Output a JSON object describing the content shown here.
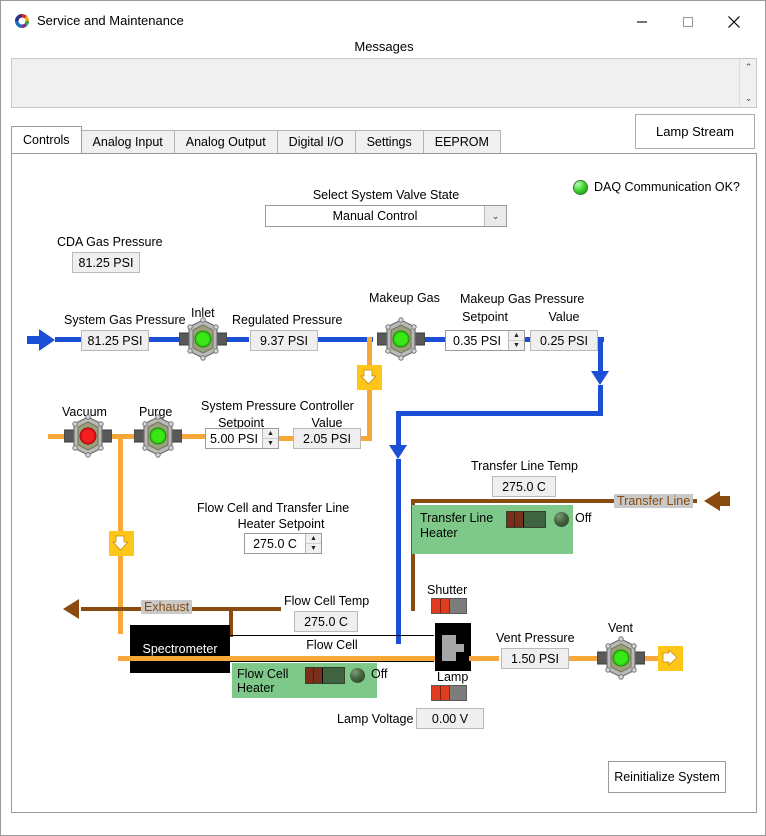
{
  "window": {
    "title": "Service and Maintenance",
    "icon": "app-icon",
    "minimize": "–",
    "maximize": "□",
    "close": "✕"
  },
  "messages": {
    "label": "Messages",
    "content": "",
    "scroll_up": "⌃",
    "scroll_down": "⌄"
  },
  "lamp_stream_button": "Lamp Stream",
  "tabs": [
    {
      "label": "Controls",
      "active": true
    },
    {
      "label": "Analog Input",
      "active": false
    },
    {
      "label": "Analog Output",
      "active": false
    },
    {
      "label": "Digital I/O",
      "active": false
    },
    {
      "label": "Settings",
      "active": false
    },
    {
      "label": "EEPROM",
      "active": false
    }
  ],
  "valve_state": {
    "label": "Select System Valve State",
    "value": "Manual Control",
    "chevron": "⌄"
  },
  "daq": {
    "label": "DAQ Communication OK?",
    "led_color": "#3ccb2a"
  },
  "cda": {
    "label": "CDA Gas Pressure",
    "value": "81.25 PSI"
  },
  "system_gas": {
    "label": "System Gas Pressure",
    "value": "81.25 PSI"
  },
  "inlet_valve": {
    "label": "Inlet",
    "state_color": "#2fd40f"
  },
  "regulated_pressure": {
    "label": "Regulated Pressure",
    "value": "9.37 PSI"
  },
  "makeup_gas": {
    "valve_label": "Makeup Gas",
    "valve_state_color": "#2fd40f",
    "group_label": "Makeup Gas Pressure",
    "setpoint_label": "Setpoint",
    "setpoint_value": "0.35 PSI",
    "value_label": "Value",
    "value": "0.25 PSI",
    "spin_up": "▲",
    "spin_down": "▼"
  },
  "vacuum_valve": {
    "label": "Vacuum",
    "state_color": "#e81414"
  },
  "purge_valve": {
    "label": "Purge",
    "state_color": "#2fd40f"
  },
  "system_pressure_controller": {
    "title_line1": "System Pressure Controller",
    "setpoint_label": "Setpoint",
    "setpoint_value": "5.00 PSI",
    "value_label": "Value",
    "value": "2.05 PSI",
    "spin_up": "▲",
    "spin_down": "▼"
  },
  "heater_setpoint": {
    "title_line1": "Flow Cell and Transfer Line",
    "title_line2": "Heater Setpoint",
    "value": "275.0 C",
    "spin_up": "▲",
    "spin_down": "▼"
  },
  "transfer_line": {
    "temp_label": "Transfer Line Temp",
    "temp_value": "275.0 C",
    "pipe_label": "Transfer Line",
    "heater_label_line1": "Transfer Line",
    "heater_label_line2": "Heater",
    "heater_state": "Off"
  },
  "flow_cell": {
    "temp_label": "Flow Cell Temp",
    "temp_value": "275.0 C",
    "body_label": "Flow Cell",
    "heater_label_line1": "Flow Cell",
    "heater_label_line2": "Heater",
    "heater_state": "Off"
  },
  "spectrometer": {
    "label": "Spectrometer"
  },
  "exhaust": {
    "label": "Exhaust"
  },
  "shutter": {
    "label": "Shutter"
  },
  "lamp": {
    "label": "Lamp",
    "voltage_label": "Lamp Voltage",
    "voltage_value": "0.00 V"
  },
  "vent": {
    "pressure_label": "Vent Pressure",
    "pressure_value": "1.50 PSI",
    "valve_label": "Vent",
    "state_color": "#2fd40f"
  },
  "reinitialize_button": "Reinitialize System"
}
